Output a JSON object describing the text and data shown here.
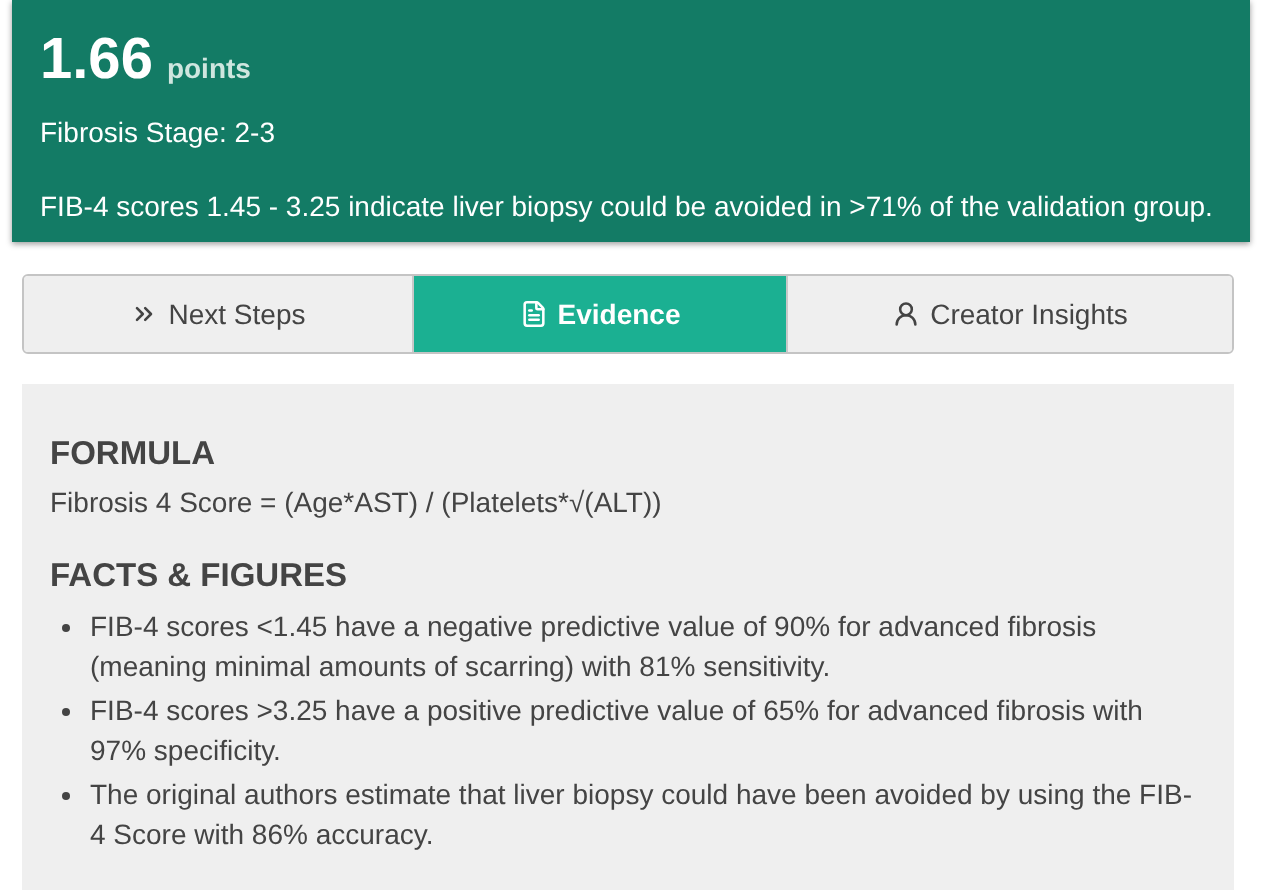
{
  "result": {
    "score": "1.66",
    "unit": "points",
    "stage": "Fibrosis Stage: 2-3",
    "note": "FIB-4 scores 1.45 - 3.25 indicate liver biopsy could be avoided in >71% of the validation group."
  },
  "tabs": [
    {
      "label": "Next Steps",
      "selected": false
    },
    {
      "label": "Evidence",
      "selected": true
    },
    {
      "label": "Creator Insights",
      "selected": false
    }
  ],
  "sections": [
    {
      "kind": "text",
      "heading": "FORMULA",
      "text": "Fibrosis 4 Score = (Age*AST) / (Platelets*√(ALT))"
    },
    {
      "kind": "list",
      "heading": "FACTS & FIGURES",
      "items": [
        "FIB-4 scores <1.45 have a negative predictive value of 90% for advanced fibrosis (meaning minimal amounts of scarring) with 81% sensitivity.",
        "FIB-4 scores >3.25 have a positive predictive value of 65% for advanced fibrosis with 97% specificity.",
        "The original authors estimate that liver biopsy could have been avoided by using the FIB-4 Score with 86% accuracy."
      ]
    }
  ]
}
